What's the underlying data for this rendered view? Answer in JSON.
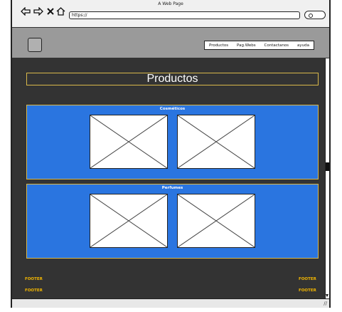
{
  "window": {
    "title": "A Web Page",
    "url": "https://"
  },
  "header": {
    "menu": [
      {
        "label": "Productos"
      },
      {
        "label": "Pag.Webs"
      },
      {
        "label": "Contactanos"
      },
      {
        "label": "ayuda"
      }
    ]
  },
  "main": {
    "title": "Productos",
    "sections": [
      {
        "label": "Cosméticos"
      },
      {
        "label": "Perfumes"
      }
    ]
  },
  "footer": {
    "left": [
      "FOOTER",
      "FOOTER"
    ],
    "right": [
      "FOOTER",
      "FOOTER"
    ]
  },
  "colors": {
    "content_bg": "#333333",
    "section_bg": "#2a75e0",
    "accent_border": "#d9b84a",
    "footer_text": "#f5b800"
  }
}
